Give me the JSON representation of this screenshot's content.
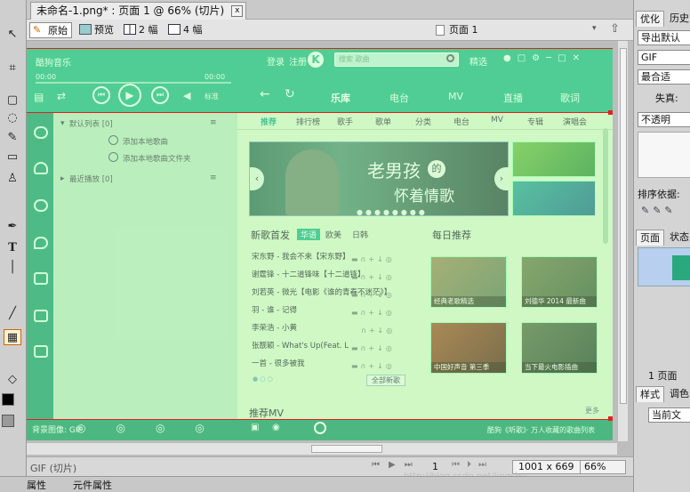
{
  "document": {
    "tab_title": "未命名-1.png* : 页面 1 @ 66% (切片)",
    "close_glyph": "x"
  },
  "view_toolbar": {
    "original": "原始",
    "preview": "预览",
    "two_up": "2 幅",
    "four_up": "4 幅",
    "page_selector": "页面 1"
  },
  "design": {
    "app_name": "酷狗音乐",
    "user_btns": [
      "登录",
      "注册"
    ],
    "logo_letter": "K",
    "search_placeholder": "搜索 歌曲",
    "vip_label": "精选",
    "time_left": "00:00",
    "time_right": "00:00",
    "main_tabs": [
      "乐库",
      "电台",
      "MV",
      "直播",
      "歌词"
    ],
    "quality": "标准",
    "playlist_header": "默认列表 [0]",
    "playlist_items": [
      "添加本地歌曲",
      "添加本地歌曲文件夹"
    ],
    "recent_header": "最近播放 [0]",
    "content_tabs": [
      "推荐",
      "排行榜",
      "歌手",
      "歌单",
      "分类",
      "电台",
      "MV",
      "专辑",
      "演唱会"
    ],
    "banner_text": [
      "老男孩",
      "的",
      "怀着情歌"
    ],
    "new_songs_title": "新歌首发",
    "new_songs_filters": [
      "华语",
      "欧美",
      "日韩"
    ],
    "songs": [
      "宋东野 - 我会不来【宋东野】",
      "谢霆锋 - 十二道锋味【十二道锋】",
      "刘若英 - 微光【电影《谁的青春不迷茫》】",
      "羽 - 谁 - 记得",
      "李荣浩 - 小黄",
      "张靓颖 - What's Up(Feat. L",
      "一首 - 很多被我"
    ],
    "daily_title": "每日推荐",
    "daily_items": [
      "经典老歌精选",
      "刘德华 2014 最新曲",
      "中国好声音 第三季",
      "当下最火电影插曲"
    ],
    "all_songs_label": "全部新歌",
    "mv_title": "推荐MV",
    "more_label": "更多",
    "bottom_status": "酷狗《听歌》· 万人收藏的歌曲列表"
  },
  "statusbar": {
    "left_text": "GIF (切片)",
    "page_num": "1",
    "dimensions": "1001 x 669",
    "zoom": "66%",
    "watermark": "http://blog.csdn.net/lingshu"
  },
  "bottom_tabs": [
    "属性",
    "元件属性"
  ],
  "canvas_caption": "背景图像: GIF",
  "right_panel": {
    "tabs": [
      "优化",
      "历史"
    ],
    "export_label": "导出默认",
    "format": "GIF",
    "palette": "最合适",
    "loss_label": "失真:",
    "transparency": "不透明",
    "sort_label": "排序依据:",
    "page_tabs": [
      "页面",
      "状态"
    ],
    "page_item": "1 页面",
    "style_tabs": [
      "样式",
      "调色"
    ],
    "style_select": "当前文"
  },
  "colors": {
    "skin_green": "#1db68a",
    "slice_overlay": "#b9f5a6",
    "slice_line": "#e02020"
  }
}
